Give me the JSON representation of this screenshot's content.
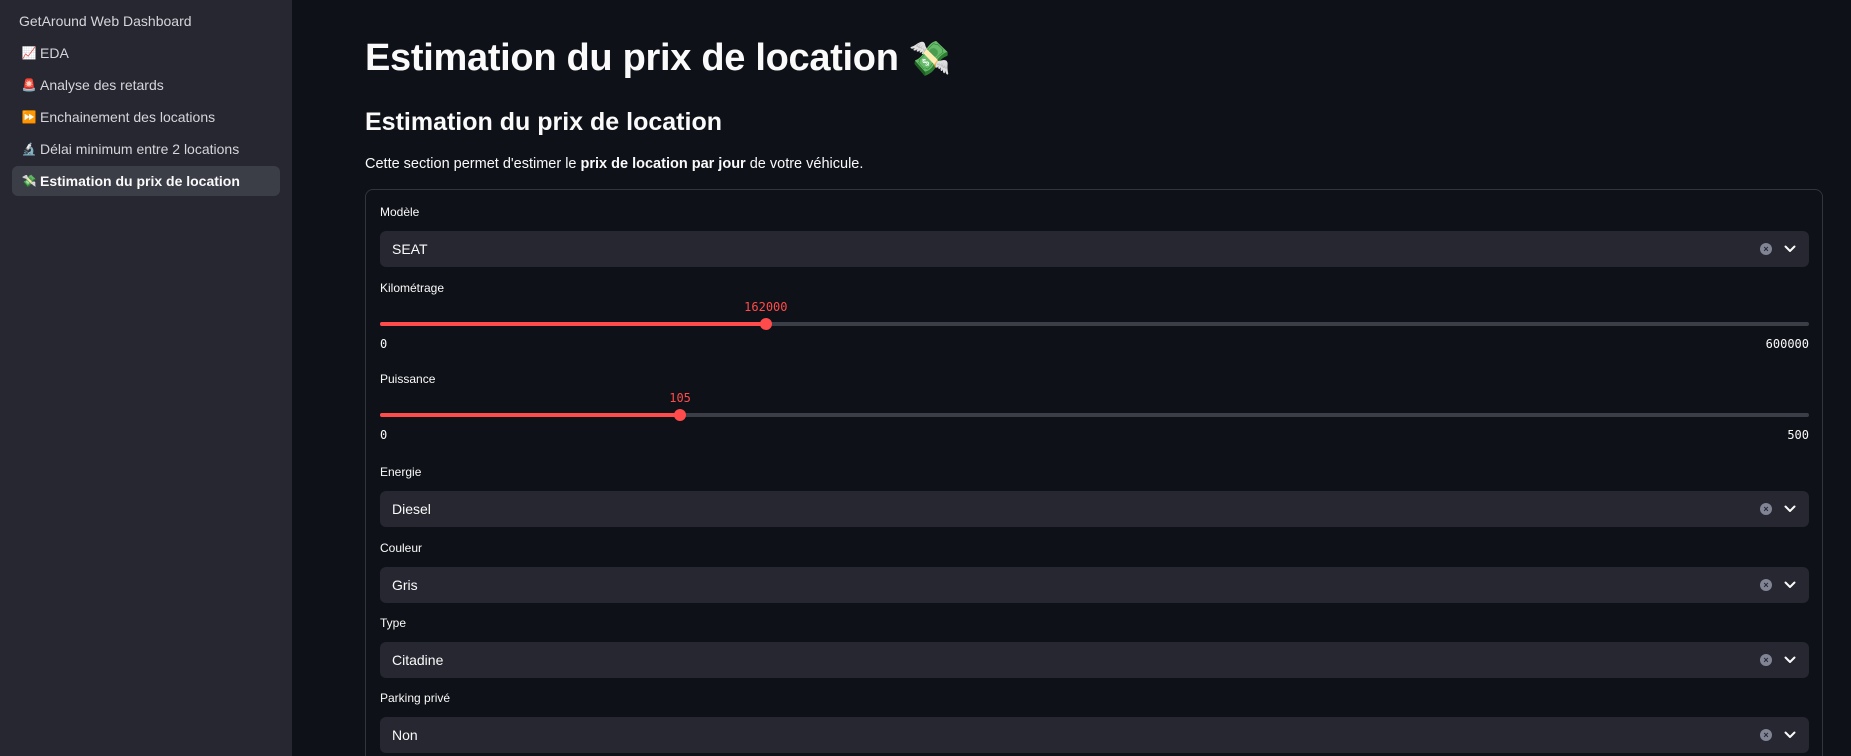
{
  "sidebar": {
    "title": "GetAround Web Dashboard",
    "items": [
      {
        "icon": "📈",
        "label": "EDA",
        "active": false
      },
      {
        "icon": "🚨",
        "label": "Analyse des retards",
        "active": false
      },
      {
        "icon": "⏩",
        "label": "Enchainement des locations",
        "active": false
      },
      {
        "icon": "🔬",
        "label": "Délai minimum entre 2 locations",
        "active": false
      },
      {
        "icon": "💸",
        "label": "Estimation du prix de location",
        "active": true
      }
    ]
  },
  "main": {
    "page_title": "Estimation du prix de location",
    "page_title_emoji": "💸",
    "section_title": "Estimation du prix de location",
    "intro_before": "Cette section permet d'estimer le ",
    "intro_bold": "prix de location par jour",
    "intro_after": " de votre véhicule."
  },
  "form": {
    "modele": {
      "label": "Modèle",
      "value": "SEAT"
    },
    "kilometrage": {
      "label": "Kilométrage",
      "value": "162000",
      "min": "0",
      "max": "600000",
      "fraction": 0.27
    },
    "puissance": {
      "label": "Puissance",
      "value": "105",
      "min": "0",
      "max": "500",
      "fraction": 0.21
    },
    "energie": {
      "label": "Energie",
      "value": "Diesel"
    },
    "couleur": {
      "label": "Couleur",
      "value": "Gris"
    },
    "type": {
      "label": "Type",
      "value": "Citadine"
    },
    "parking": {
      "label": "Parking privé",
      "value": "Non"
    }
  },
  "colors": {
    "accent": "#ff4b4b",
    "background": "#0e1117",
    "sidebar": "#262730"
  }
}
